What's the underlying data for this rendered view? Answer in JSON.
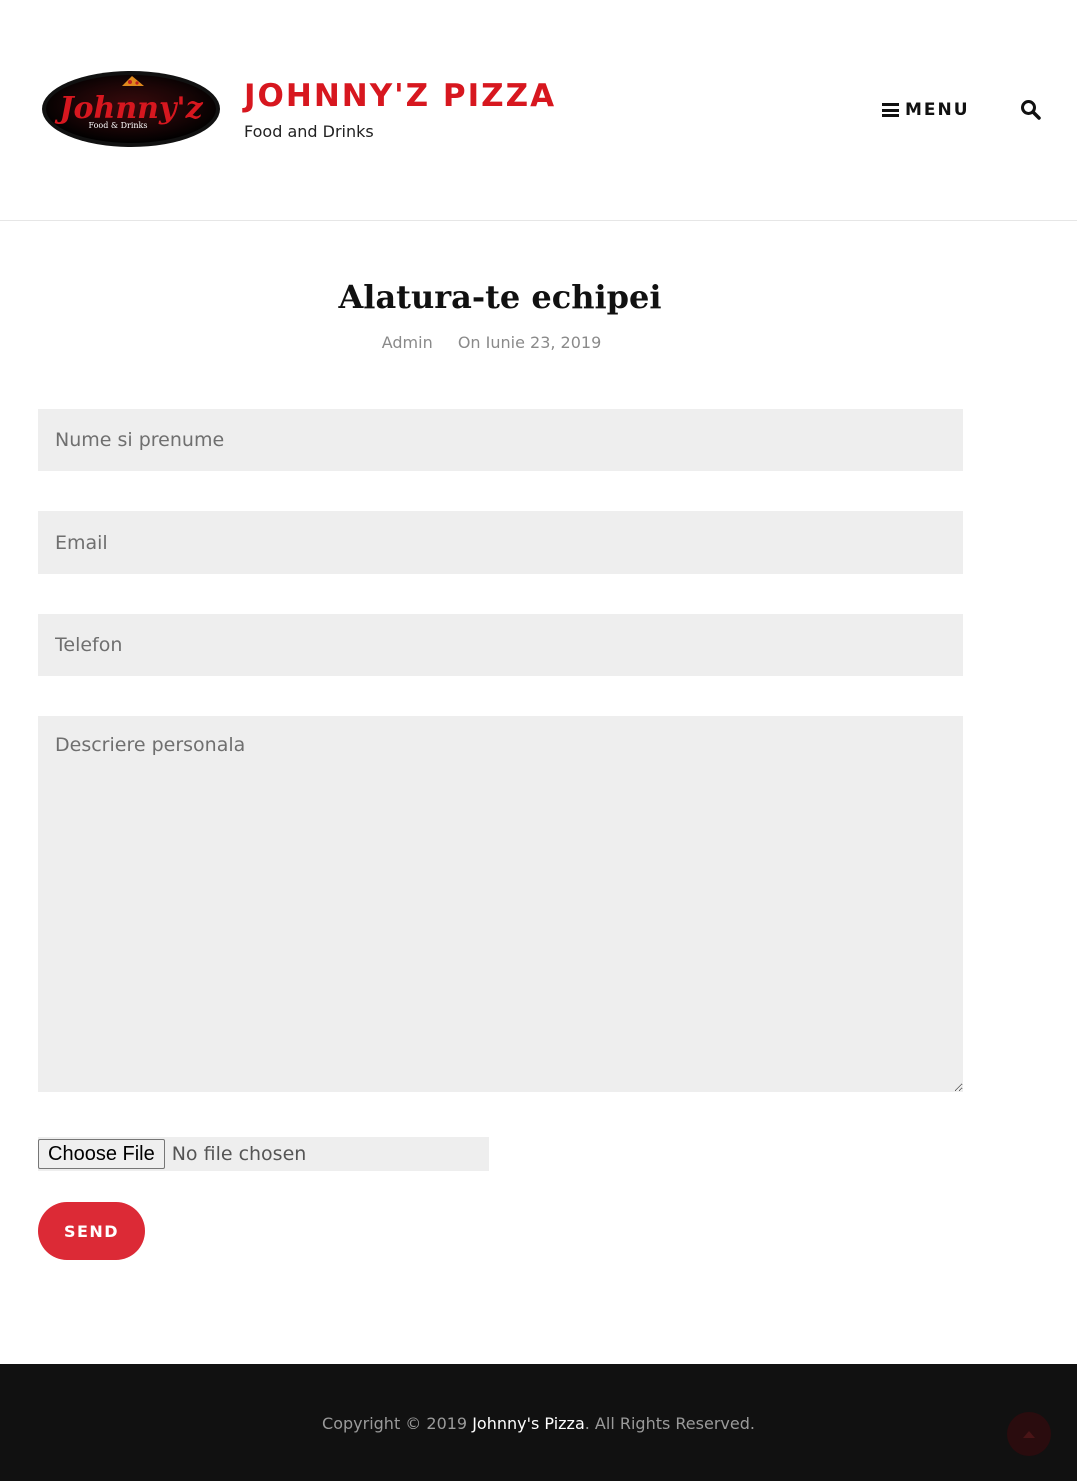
{
  "header": {
    "site_title": "JOHNNY'Z PIZZA",
    "tagline": "Food and Drinks",
    "logo": {
      "script_text": "Johnny'z",
      "sub_text": "Food & Drinks"
    },
    "menu_label": "MENU",
    "menu_icon": "hamburger-icon",
    "search_icon": "search-icon"
  },
  "post": {
    "title": "Alatura-te echipei",
    "author": "Admin",
    "date": "On Iunie 23, 2019"
  },
  "form": {
    "name_placeholder": "Nume si prenume",
    "email_placeholder": "Email",
    "phone_placeholder": "Telefon",
    "description_placeholder": "Descriere personala",
    "file_button_label": "Choose File",
    "file_status": "No file chosen",
    "send_label": "SEND"
  },
  "footer": {
    "copyright_prefix": "Copyright © 2019 ",
    "brand_name": "Johnny's Pizza",
    "copyright_suffix": ". All Rights Reserved.",
    "back_to_top_icon": "arrow-up-icon"
  },
  "colors": {
    "accent_red": "#d7171f",
    "button_red": "#dc2a36",
    "field_bg": "#eeeeee",
    "footer_bg": "#111111"
  }
}
